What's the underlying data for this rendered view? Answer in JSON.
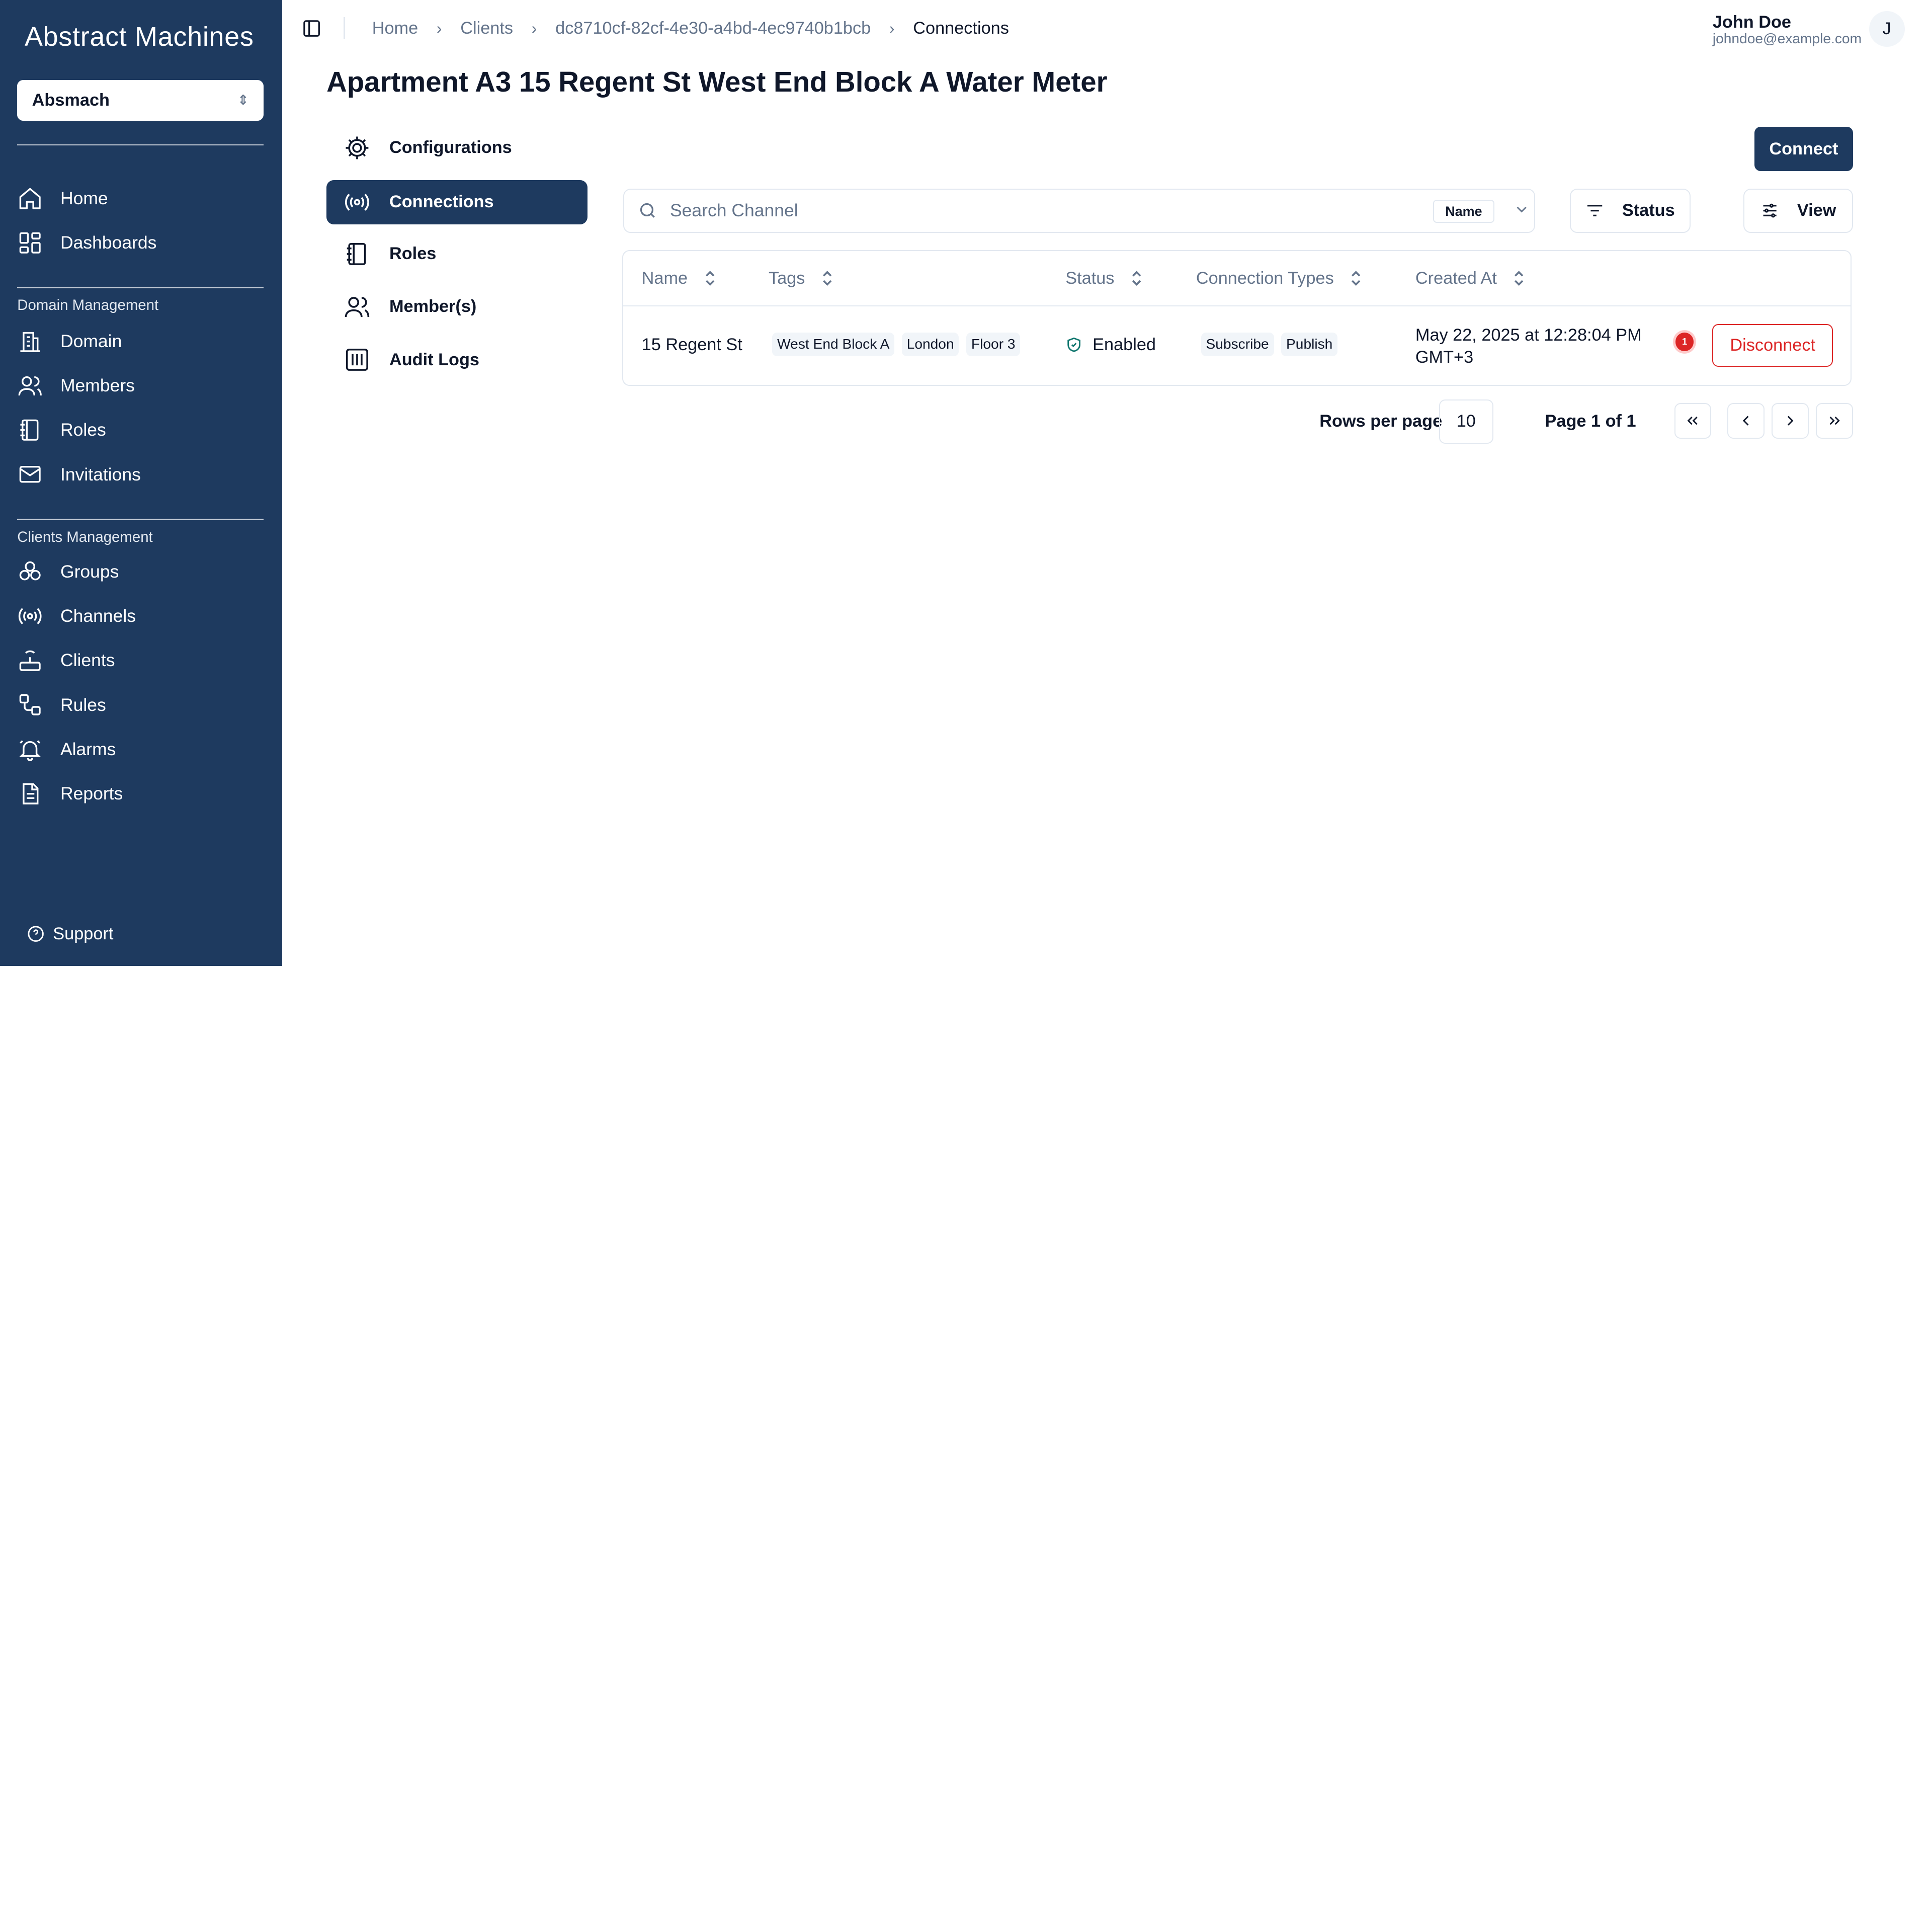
{
  "sidebar": {
    "logo": "Abstract Machines",
    "org_select": "Absmach",
    "items_top": [
      {
        "label": "Home",
        "icon": "home-icon"
      },
      {
        "label": "Dashboards",
        "icon": "dashboard-icon"
      }
    ],
    "domain_section": "Domain Management",
    "items_domain": [
      {
        "label": "Domain",
        "icon": "building-icon"
      },
      {
        "label": "Members",
        "icon": "users-icon"
      },
      {
        "label": "Roles",
        "icon": "notebook-icon"
      },
      {
        "label": "Invitations",
        "icon": "mail-icon"
      }
    ],
    "clients_section": "Clients Management",
    "items_clients": [
      {
        "label": "Groups",
        "icon": "groups-icon"
      },
      {
        "label": "Channels",
        "icon": "radio-icon"
      },
      {
        "label": "Clients",
        "icon": "router-icon"
      },
      {
        "label": "Rules",
        "icon": "workflow-icon"
      },
      {
        "label": "Alarms",
        "icon": "bell-icon"
      },
      {
        "label": "Reports",
        "icon": "report-icon"
      }
    ],
    "support": "Support"
  },
  "header": {
    "breadcrumb": [
      "Home",
      "Clients",
      "dc8710cf-82cf-4e30-a4bd-4ec9740b1bcb",
      "Connections"
    ],
    "user_name": "John Doe",
    "user_email": "johndoe@example.com",
    "avatar_initial": "J"
  },
  "page_title": "Apartment A3 15 Regent St West End Block A Water Meter",
  "subnav": [
    {
      "label": "Configurations",
      "icon": "gear-icon"
    },
    {
      "label": "Connections",
      "icon": "radio-icon",
      "active": true
    },
    {
      "label": "Roles",
      "icon": "notebook-icon"
    },
    {
      "label": "Member(s)",
      "icon": "users-icon"
    },
    {
      "label": "Audit Logs",
      "icon": "logs-icon"
    }
  ],
  "toolbar": {
    "connect_label": "Connect",
    "search_placeholder": "Search Channel",
    "search_field": "Name",
    "status_label": "Status",
    "view_label": "View"
  },
  "table": {
    "columns": [
      "Name",
      "Tags",
      "Status",
      "Connection Types",
      "Created At"
    ],
    "rows": [
      {
        "name": "15 Regent St",
        "tags": [
          "West End Block A",
          "London",
          "Floor 3"
        ],
        "status": "Enabled",
        "connection_types": [
          "Subscribe",
          "Publish"
        ],
        "created_at_line1": "May 22, 2025 at 12:28:04 PM",
        "created_at_line2": "GMT+3",
        "badge": "1",
        "action": "Disconnect"
      }
    ]
  },
  "pagination": {
    "rows_per_page_label": "Rows per page",
    "rows_per_page": "10",
    "page_info": "Page 1 of 1"
  },
  "colors": {
    "sidebar": "#1e3a5f",
    "primary": "#1e3a5f",
    "danger": "#dc2626"
  }
}
